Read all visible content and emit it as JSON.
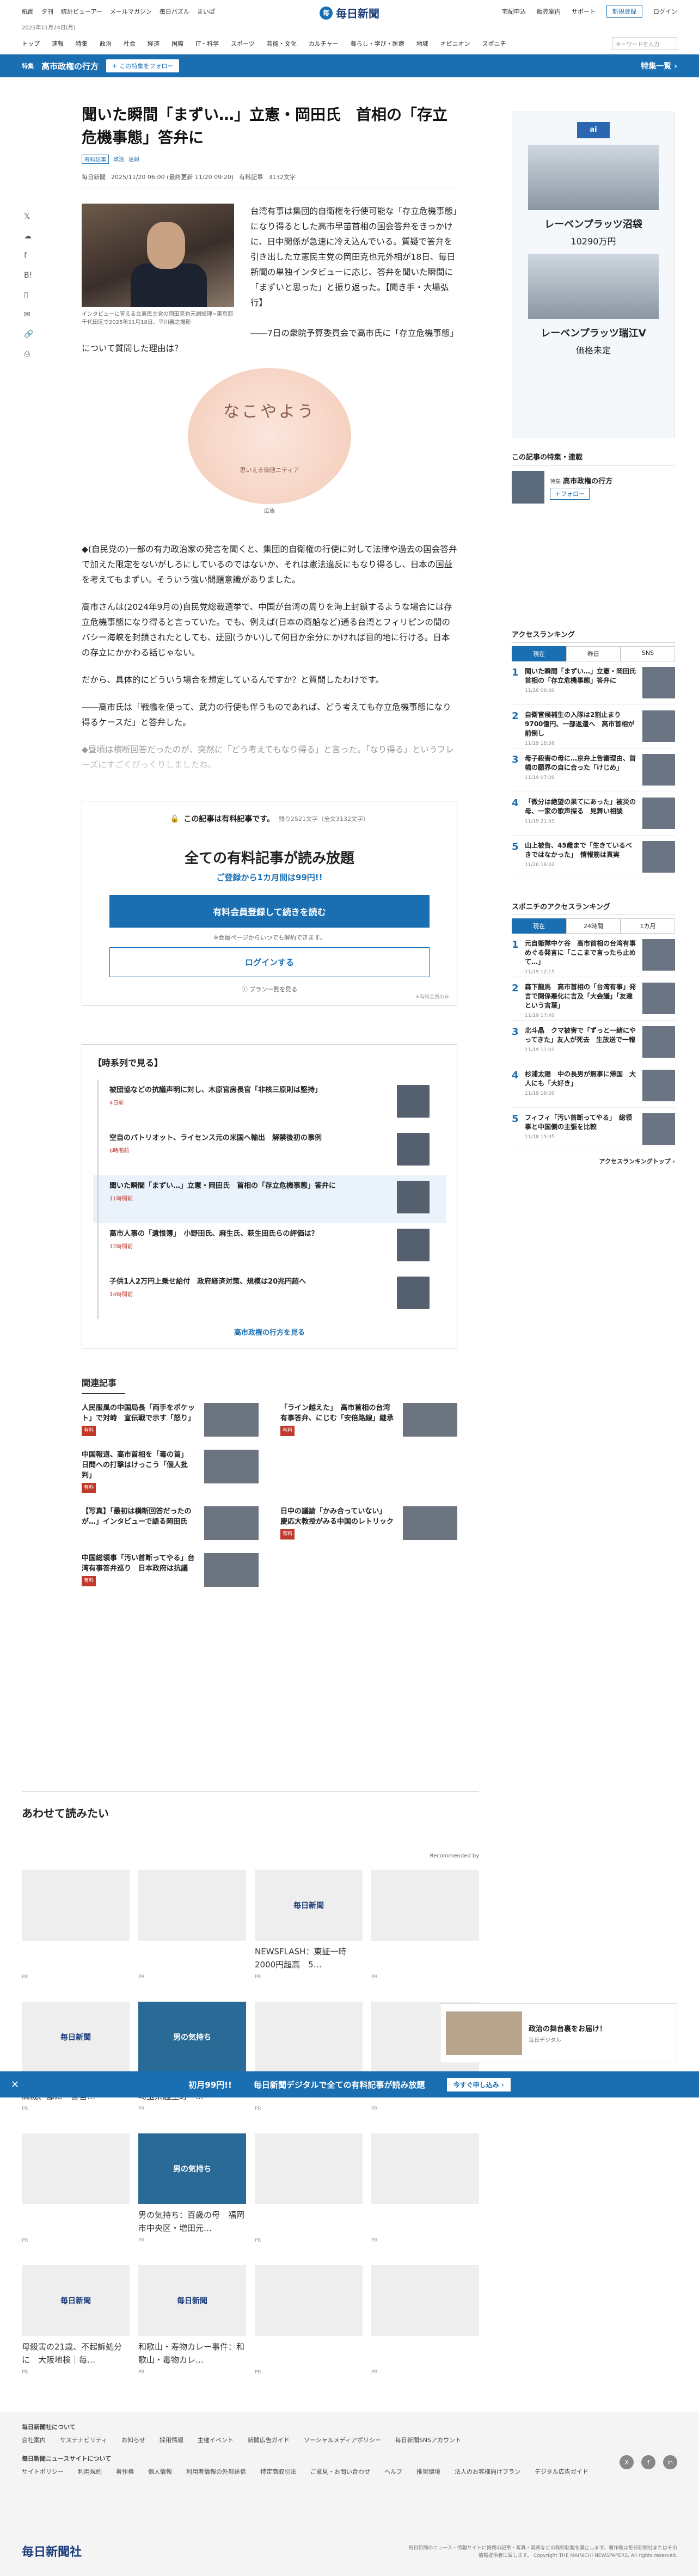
{
  "topbar": {
    "links": [
      "紙面",
      "夕刊",
      "統計ビューアー",
      "メールマガジン",
      "毎日パズル",
      "まいぱ"
    ],
    "brand": "毎日新聞",
    "right": [
      "宅配申込",
      "販売案内",
      "サポート"
    ],
    "register": "新規登録",
    "login": "ログイン",
    "date": "2025年11月24日(月)"
  },
  "nav": {
    "items": [
      "トップ",
      "速報",
      "特集",
      "政治",
      "社会",
      "経済",
      "国際",
      "IT・科学",
      "スポーツ",
      "芸能・文化",
      "カルチャー",
      "暮らし・学び・医療",
      "地域",
      "オピニオン",
      "スポニチ"
    ],
    "search_placeholder": "キーワードを入力"
  },
  "feature": {
    "tag": "特集",
    "title": "高市政権の行方",
    "follow": "＋ この特集をフォロー",
    "list": "特集一覧 ›"
  },
  "article": {
    "title": "聞いた瞬間「まずい…」立憲・岡田氏　首相の「存立危機事態」答弁に",
    "tags": [
      "有料記事",
      "政治",
      "速報"
    ],
    "source": "毎日新聞",
    "time": "2025/11/20 06:00 (最終更新 11/20 09:20)",
    "badge": "有料記事",
    "chars": "3132文字",
    "caption": "インタビューに答える立憲民主党の岡田克也元副総理=東京都千代田区で2025年11月18日、平川義之撮影",
    "paragraphs": [
      "台湾有事は集団的自衛権を行使可能な「存立危機事態」になり得るとした高市早苗首相の国会答弁をきっかけに、日中関係が急速に冷え込んでいる。質疑で答弁を引き出した立憲民主党の岡田克也元外相が18日、毎日新聞の単独インタビューに応じ、答弁を聞いた瞬間に「まずいと思った」と振り返った。【聞き手・大場弘行】",
      "――7日の衆院予算委員会で高市氏に「存立危機事態」について質問した理由は？",
      "◆(自民党の)一部の有力政治家の発言を聞くと、集団的自衛権の行使に対して法律や過去の国会答弁で加えた限定をないがしろにしているのではないか、それは憲法違反にもなり得るし、日本の国益を考えてもまずい。そういう強い問題意識がありました。",
      "高市さんは(2024年9月の)自民党総裁選挙で、中国が台湾の周りを海上封鎖するような場合には存立危機事態になり得ると言っていた。でも、例えば(日本の商船など)通る台湾とフィリピンの間のバシー海峡を封鎖されたとしても、迂回(うかい)して何日か余分にかければ目的地に行ける。日本の存立にかかわる話じゃない。",
      "だから、具体的にどういう場合を想定しているんですか？と質問したわけです。",
      "――高市氏は「戦艦を使って、武力の行使も伴うものであれば、どう考えても存立危機事態になり得るケースだ」と答弁した。",
      "◆昼頃は横断回答だったのが、突然に「どう考えてもなり得る」と言った。「なり得る」というフレーズにすごくびっくりしましたね。"
    ],
    "ad_text": "なこやよう",
    "ad_sub": "思いえる価値ニティア",
    "ad_label": "広告"
  },
  "paywall": {
    "top": "この記事は有料記事です。",
    "rest": "残り2521文字（全文3132文字）",
    "heading": "全ての有料記事が読み放題",
    "sub": "ご登録から1カ月間は99円!!",
    "cta": "有料会員登録して続きを読む",
    "note": "※会員ページからいつでも解約できます。",
    "login": "ログインする",
    "plan": "ⓘ プラン一覧を見る",
    "foot": "※有料会員のみ"
  },
  "timeline": {
    "heading": "【時系列で見る】",
    "items": [
      {
        "title": "被団協などの抗議声明に対し、木原官房長官「非核三原則は堅持」",
        "date": "4日前"
      },
      {
        "title": "空自のパトリオット、ライセンス元の米国へ輸出　解禁後初の事例",
        "date": "6時間前"
      },
      {
        "title": "聞いた瞬間「まずい…」立憲・岡田氏　首相の「存立危機事態」答弁に",
        "date": "11時間前"
      },
      {
        "title": "高市人事の「遺恨簿」　小野田氏、麻生氏、萩生田氏らの評価は？",
        "date": "12時間前"
      },
      {
        "title": "子供1人2万円上乗せ給付　政府経済対策、規模は20兆円超へ",
        "date": "14時間前"
      }
    ],
    "more": "高市政権の行方を見る"
  },
  "related": {
    "heading": "関連記事",
    "items": [
      {
        "title": "人民服風の中国局長「両手をポケット」で対峙　宣伝戦で示す「怒り」",
        "badge": "有料"
      },
      {
        "title": "「ライン越えた」　高市首相の台湾有事答弁、にじむ「安倍路線」継承",
        "badge": "有料"
      },
      {
        "title": "中国報道、高市首相を「毒の首」　日問への打撃はけっこう「個人批判」",
        "badge": "有料"
      },
      {
        "title": "",
        "badge": ""
      },
      {
        "title": "【写真】「最初は横断回答だったのが…」インタビューで語る岡田氏",
        "badge": ""
      },
      {
        "title": "日中の議論「かみ合っていない」　慶応大教授がみる中国のレトリック",
        "badge": "有料"
      },
      {
        "title": "中国総領事「汚い首断ってやる」台湾有事答弁巡り　日本政府は抗議",
        "badge": "有料"
      }
    ]
  },
  "awasete": {
    "heading": "あわせて読みたい",
    "recommended": "Recommended by",
    "cards": [
      {
        "caption": "",
        "logo": ""
      },
      {
        "caption": "",
        "logo": ""
      },
      {
        "caption": "NEWSFLASH：東証一時2000円超高　5…",
        "logo": "毎日新聞"
      },
      {
        "caption": "",
        "logo": ""
      },
      {
        "caption": "聡僕増額、1審の39倍　東京高裁、都に　警官…",
        "logo": "毎日新聞"
      },
      {
        "caption": "男の気持ち：ありがとうトラ　埼玉県越生町・…",
        "logo": "男の気持ち"
      },
      {
        "caption": "",
        "logo": ""
      },
      {
        "caption": "",
        "logo": ""
      },
      {
        "caption": "",
        "logo": ""
      },
      {
        "caption": "男の気持ち：百歳の母　福岡市中央区・増田元…",
        "logo": "男の気持ち"
      },
      {
        "caption": "",
        "logo": ""
      },
      {
        "caption": "",
        "logo": ""
      },
      {
        "caption": "母殺害の21歳、不起訴処分に　大阪地検｜毎…",
        "logo": "毎日新聞"
      },
      {
        "caption": "和歌山・寿物カレー事件：和歌山・毒物カレ…",
        "logo": "毎日新聞"
      },
      {
        "caption": "",
        "logo": ""
      },
      {
        "caption": "",
        "logo": ""
      }
    ],
    "pr": "PR"
  },
  "sidebar": {
    "ad": {
      "brand": "ai",
      "name": "レーベンプラッツ沼袋",
      "price": "10290万円",
      "name2": "レーベンプラッツ瑞江V",
      "price2": "価格未定"
    },
    "follow_heading": "この記事の特集・連載",
    "follow_tag": "特集",
    "follow_title": "高市政権の行方",
    "follow_btn": "＋フォロー",
    "rank_heading": "アクセスランキング",
    "tabs": [
      "現在",
      "昨日",
      "SNS"
    ],
    "ranks": [
      {
        "title": "聞いた瞬間「まずい…」立憲・岡田氏　首相の「存立危機事態」答弁に",
        "date": "11/20 06:00"
      },
      {
        "title": "自衛官候補生の入隊は2割止まり　9700億円、一部返還へ　高市首相が前倒し",
        "date": "11/19 18:36"
      },
      {
        "title": "母子殺害の母に…京弁上告審理由、首幅の願界の自に合った「けじめ」",
        "date": "11/19 07:00"
      },
      {
        "title": "「微分は絶望の果てにあった」被災の母、一家の歌声探る　見舞い相談",
        "date": "11/19 21:55"
      },
      {
        "title": "山上被告、45歳まで「生きているべきではなかった」　情報筋は真実",
        "date": "11/20 16:02"
      }
    ],
    "rank2_heading": "スポニチのアクセスランキング",
    "tabs2": [
      "現在",
      "24時間",
      "1カ月"
    ],
    "ranks2": [
      {
        "title": "元自衛隊中ケ谷　高市首相の台湾有事めぐる発言に「ここまで言ったら止めて…」",
        "date": "11/19 12:15"
      },
      {
        "title": "森下龍馬　高市首相の「台湾有事」発言で関係悪化に言及「大会議」「友達という言葉」",
        "date": "11/19 17:40"
      },
      {
        "title": "北斗晶　クマ被害で「ずっと一緒にやってきた」友人が死去　生放送で一報",
        "date": "11/19 11:01"
      },
      {
        "title": "杉浦太陽　中の長男が無事に帰国　大人にも「大好き」",
        "date": "11/19 18:00"
      },
      {
        "title": "フィフィ「汚い首断ってやる」　総領事と中国側の主張を比較",
        "date": "11/18 15:35"
      }
    ],
    "rank_more": "アクセスランキングトップ ›"
  },
  "float_ad": {
    "text": "政治の舞台裏をお届け！",
    "sub": "毎日デジタル"
  },
  "bottom_bar": {
    "close": "✕",
    "l1": "初月99円!!",
    "l2": "毎日新聞デジタルで全ての有料記事が読み放題",
    "go": "今すぐ申し込み ›"
  },
  "footer": {
    "h1": "毎日新聞社について",
    "row1": [
      "会社案内",
      "サステナビリティ",
      "お知らせ",
      "採用情報",
      "主催イベント",
      "新聞広告ガイド",
      "ソーシャルメディアポリシー",
      "毎日新聞SNSアカウント"
    ],
    "h2": "毎日新聞ニュースサイトについて",
    "row2": [
      "サイトポリシー",
      "利用規約",
      "著作権",
      "個人情報",
      "利用者情報の外部送信",
      "特定商取引法",
      "ご意見・お問い合わせ",
      "ヘルプ",
      "推奨環境",
      "法人のお客様向けプラン",
      "デジタル広告ガイド"
    ],
    "logo": "毎日新聞社",
    "copy": "毎日新聞のニュース・情報サイトに掲載の記事・写真・図表などの無断転載を禁止します。著作権は毎日新聞社またはその情報提供者に属します。 Copyright THE MAINICHI NEWSPAPERS. All rights reserved.",
    "social": [
      "X",
      "f",
      "in"
    ]
  }
}
